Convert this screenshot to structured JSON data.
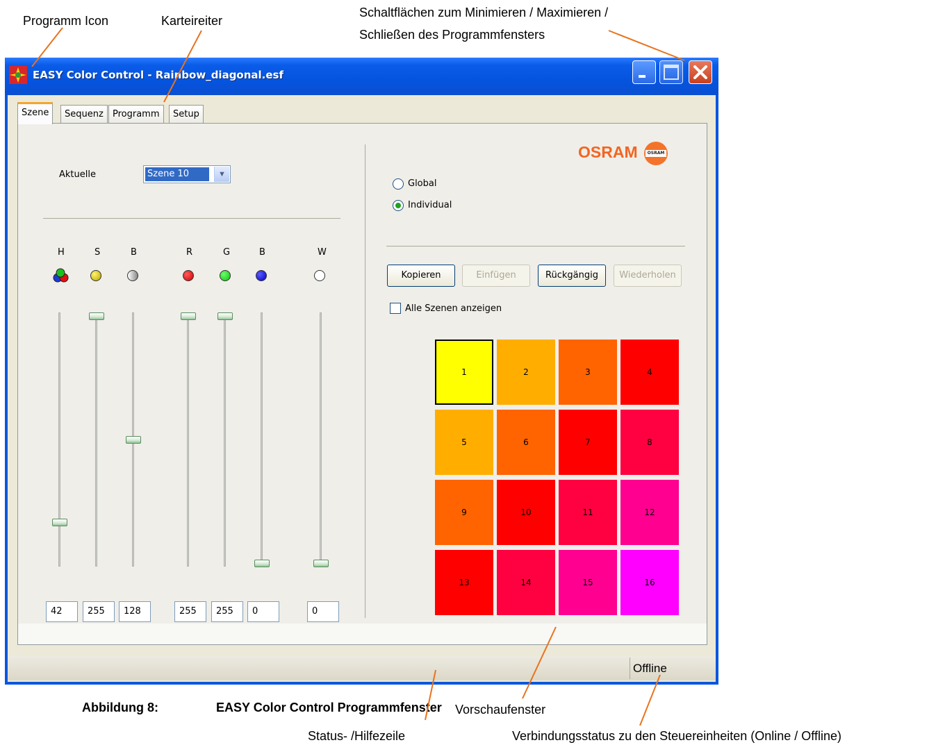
{
  "annotations": {
    "program_icon": "Programm Icon",
    "tabs": "Karteireiter",
    "window_buttons_line1": "Schaltflächen zum Minimieren / Maximieren /",
    "window_buttons_line2": "Schließen des Programmfensters",
    "caption_number": "Abbildung 8:",
    "caption_title": "EASY Color Control Programmfenster",
    "preview": "Vorschaufenster",
    "status_help": "Status- /Hilfezeile",
    "connection_status": "Verbindungsstatus zu den Steuereinheiten (Online / Offline)"
  },
  "window": {
    "title": "EASY Color Control - Rainbow_diagonal.esf"
  },
  "tabs": [
    "Szene",
    "Sequenz",
    "Programm",
    "Setup"
  ],
  "active_tab": "Szene",
  "scene": {
    "current_label": "Aktuelle",
    "current_value": "Szene 10"
  },
  "sliders": [
    {
      "label": "H",
      "value": "42",
      "level": 0.165
    },
    {
      "label": "S",
      "value": "255",
      "level": 1.0
    },
    {
      "label": "B",
      "value": "128",
      "level": 0.5
    },
    {
      "label": "R",
      "value": "255",
      "level": 1.0
    },
    {
      "label": "G",
      "value": "255",
      "level": 1.0
    },
    {
      "label": "B",
      "value": "0",
      "level": 0.0
    },
    {
      "label": "W",
      "value": "0",
      "level": 0.0
    }
  ],
  "mode": {
    "global_label": "Global",
    "individual_label": "Individual",
    "selected": "Individual"
  },
  "buttons": {
    "copy": "Kopieren",
    "paste": "Einfügen",
    "undo": "Rückgängig",
    "redo": "Wiederholen"
  },
  "show_all_scenes_label": "Alle Szenen anzeigen",
  "logo": {
    "text": "OSRAM",
    "bulb_text": "OSRAM"
  },
  "preview_cells": [
    {
      "label": "1",
      "color": "#ffff00"
    },
    {
      "label": "2",
      "color": "#ffae00"
    },
    {
      "label": "3",
      "color": "#ff6400"
    },
    {
      "label": "4",
      "color": "#ff0000"
    },
    {
      "label": "5",
      "color": "#ffae00"
    },
    {
      "label": "6",
      "color": "#ff6400"
    },
    {
      "label": "7",
      "color": "#ff0000"
    },
    {
      "label": "8",
      "color": "#ff0040"
    },
    {
      "label": "9",
      "color": "#ff6400"
    },
    {
      "label": "10",
      "color": "#ff0000"
    },
    {
      "label": "11",
      "color": "#ff0040"
    },
    {
      "label": "12",
      "color": "#ff0090"
    },
    {
      "label": "13",
      "color": "#ff0000"
    },
    {
      "label": "14",
      "color": "#ff0040"
    },
    {
      "label": "15",
      "color": "#ff0090"
    },
    {
      "label": "16",
      "color": "#ff00ff"
    }
  ],
  "selected_cell": "1",
  "status": {
    "help_text": "",
    "connection": "Offline"
  }
}
